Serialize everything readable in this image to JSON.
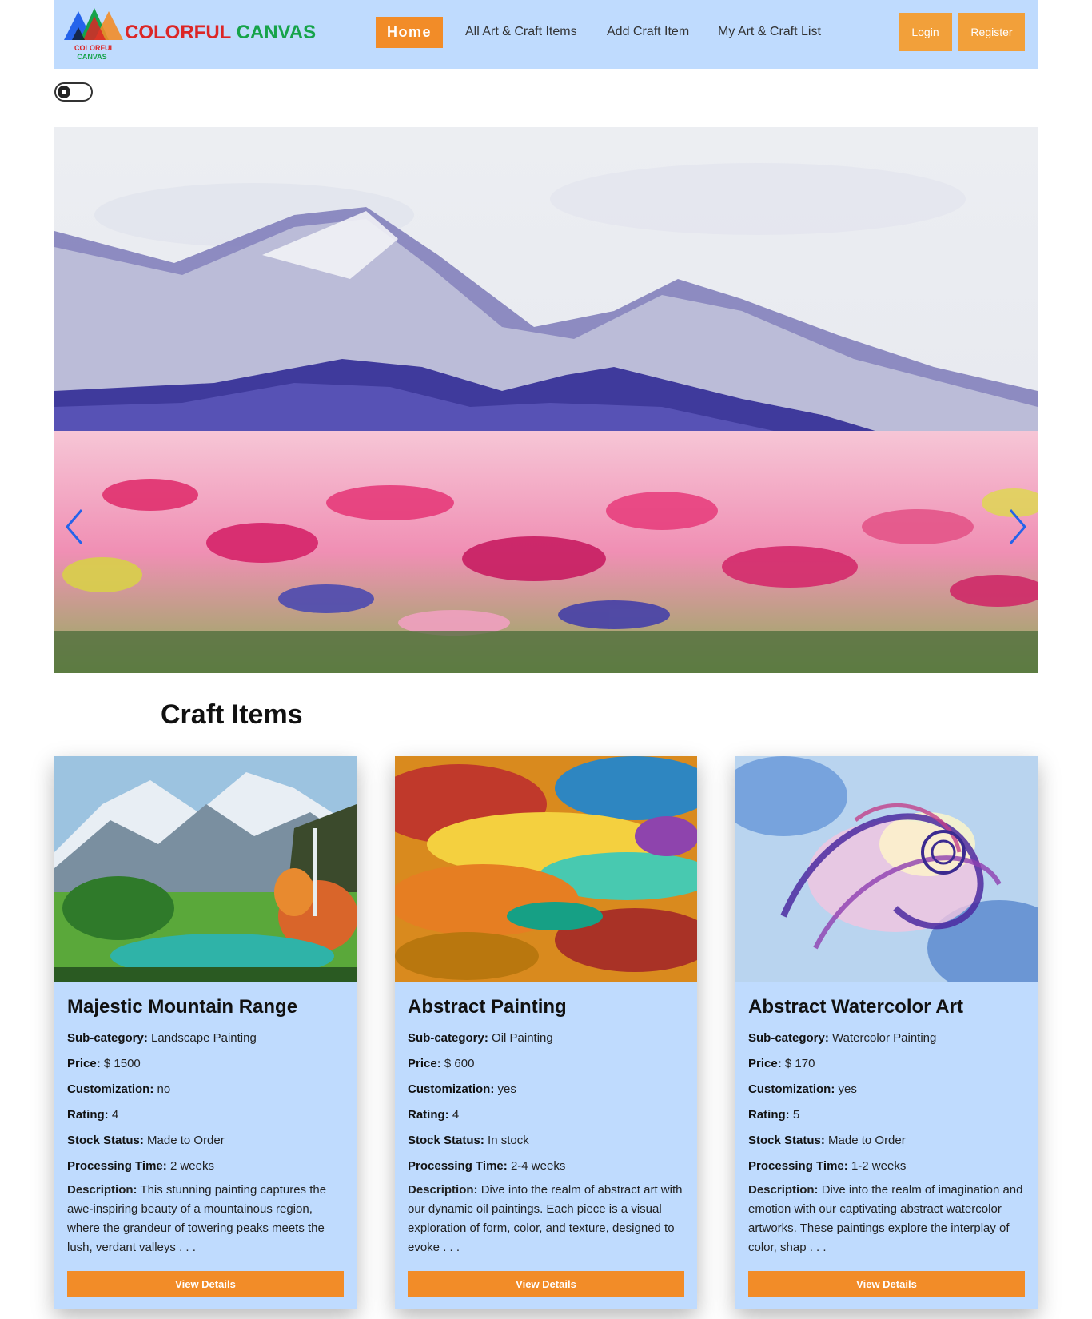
{
  "brand": {
    "part1": "COLORFUL",
    "part2": "CANVAS",
    "logo_text_1": "COLORFUL",
    "logo_text_2": "CANVAS"
  },
  "nav": {
    "home": "Home",
    "links": [
      "All Art & Craft Items",
      "Add Craft Item",
      "My Art & Craft List"
    ],
    "login": "Login",
    "register": "Register"
  },
  "theme_toggle": {
    "icon": "gear-icon",
    "state": "off"
  },
  "hero": {
    "image": "watercolor mountains with flower meadow",
    "prev_icon": "chevron-left-icon",
    "next_icon": "chevron-right-icon"
  },
  "section": {
    "title": "Craft Items"
  },
  "labels": {
    "subcategory": "Sub-category:",
    "price": "Price:",
    "customization": "Customization:",
    "rating": "Rating:",
    "stock": "Stock Status:",
    "processing": "Processing Time:",
    "description": "Description:"
  },
  "cards": [
    {
      "title": "Majestic Mountain Range",
      "subcategory": "Landscape Painting",
      "price": "$ 1500",
      "customization": "no",
      "rating": "4",
      "stock": "Made to Order",
      "processing": "2 weeks",
      "description": "This stunning painting captures the awe-inspiring beauty of a mountainous region, where the grandeur of towering peaks meets the lush, verdant valleys . . .",
      "button": "View Details"
    },
    {
      "title": "Abstract Painting",
      "subcategory": "Oil Painting",
      "price": "$ 600",
      "customization": "yes",
      "rating": "4",
      "stock": "In stock",
      "processing": "2-4 weeks",
      "description": "Dive into the realm of abstract art with our dynamic oil paintings. Each piece is a visual exploration of form, color, and texture, designed to evoke . . .",
      "button": "View Details"
    },
    {
      "title": "Abstract Watercolor Art",
      "subcategory": "Watercolor Painting",
      "price": "$ 170",
      "customization": "yes",
      "rating": "5",
      "stock": "Made to Order",
      "processing": "1-2 weeks",
      "description": "Dive into the realm of imagination and emotion with our captivating abstract watercolor artworks. These paintings explore the interplay of color, shap . . .",
      "button": "View Details"
    }
  ],
  "colors": {
    "navbar": "#bfdbfe",
    "accent": "#f28c28",
    "card_bg": "#bfdbfe"
  }
}
